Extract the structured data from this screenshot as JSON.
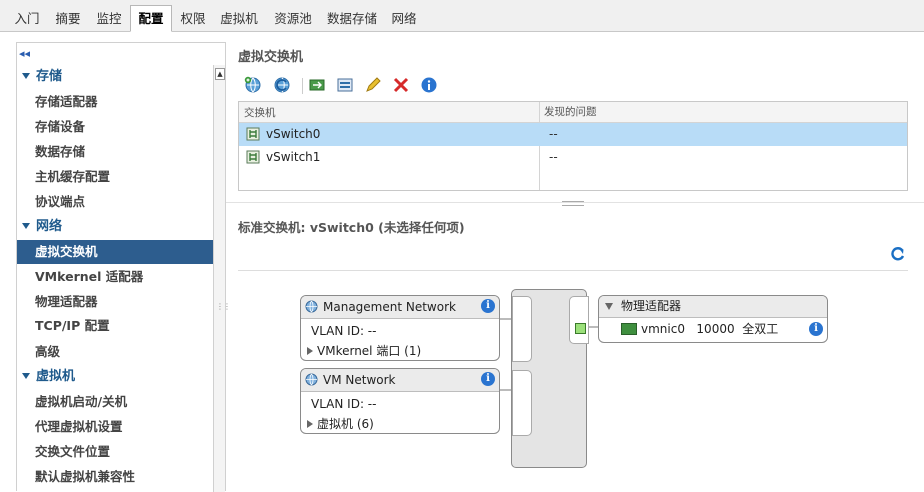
{
  "tabs": [
    "入门",
    "摘要",
    "监控",
    "配置",
    "权限",
    "虚拟机",
    "资源池",
    "数据存储",
    "网络"
  ],
  "active_tab": "配置",
  "sidebar": {
    "collapse_glyph": "◂◂",
    "sections": [
      {
        "label": "存储",
        "items": [
          "存储适配器",
          "存储设备",
          "数据存储",
          "主机缓存配置",
          "协议端点"
        ]
      },
      {
        "label": "网络",
        "items": [
          "虚拟交换机",
          "VMkernel 适配器",
          "物理适配器",
          "TCP/IP 配置",
          "高级"
        ]
      },
      {
        "label": "虚拟机",
        "items": [
          "虚拟机启动/关机",
          "代理虚拟机设置",
          "交换文件位置",
          "默认虚拟机兼容性"
        ]
      }
    ],
    "selected_item": "虚拟交换机"
  },
  "panel": {
    "title": "虚拟交换机",
    "toolbar_icons": [
      "add-networking-icon",
      "refresh-icon",
      "migrate-adapter-icon",
      "view-settings-icon",
      "edit-icon",
      "delete-icon",
      "info-icon"
    ]
  },
  "grid": {
    "columns": [
      "交换机",
      "发现的问题"
    ],
    "rows": [
      {
        "name": "vSwitch0",
        "problem": "--",
        "selected": true
      },
      {
        "name": "vSwitch1",
        "problem": "--",
        "selected": false
      }
    ]
  },
  "detail": {
    "title": "标准交换机: vSwitch0 (未选择任何项)",
    "port_groups": [
      {
        "name": "Management Network",
        "vlan": "VLAN ID: --",
        "sub": "VMkernel 端口 (1)"
      },
      {
        "name": "VM Network",
        "vlan": "VLAN ID: --",
        "sub": "虚拟机 (6)"
      }
    ],
    "physical": {
      "title": "物理适配器",
      "nic": "vmnic0",
      "speed": "10000",
      "duplex": "全双工"
    }
  },
  "colors": {
    "selected_sidebar": "#2d5d8e",
    "selected_row": "#b8dcf7",
    "link_blue": "#1f5a8c",
    "info_blue": "#2a74d0",
    "delete_red": "#d62a2a"
  }
}
